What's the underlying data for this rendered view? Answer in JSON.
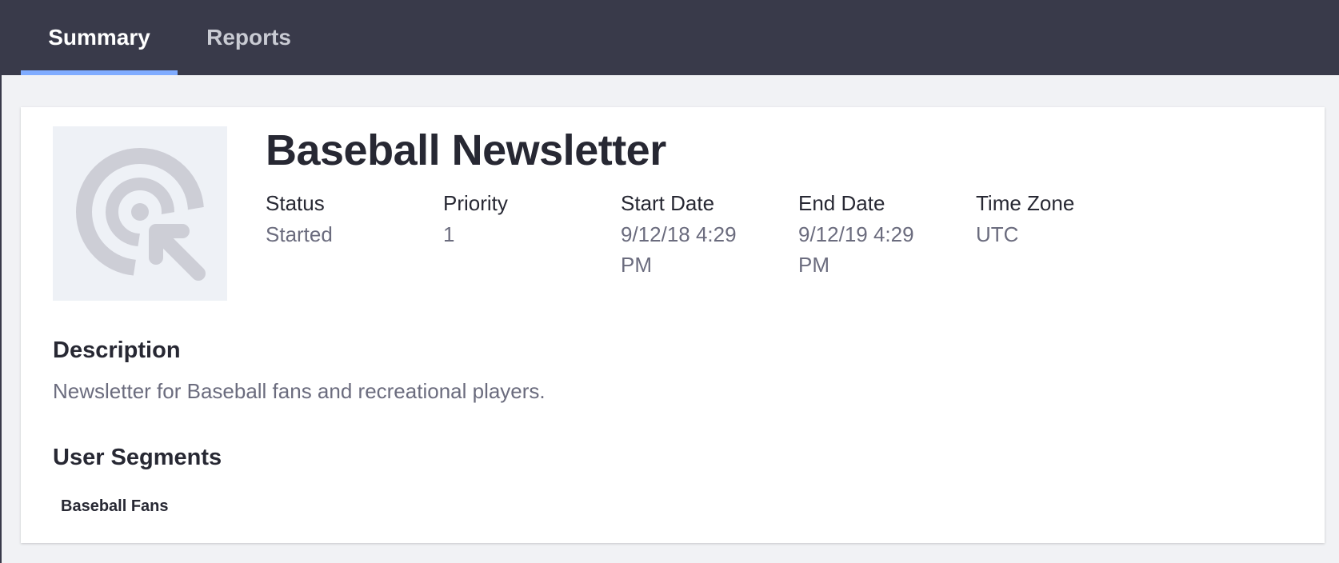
{
  "tabs": [
    {
      "label": "Summary",
      "active": true
    },
    {
      "label": "Reports",
      "active": false
    }
  ],
  "campaign": {
    "icon": "target-cursor-icon",
    "title": "Baseball Newsletter",
    "meta": {
      "status": {
        "label": "Status",
        "value": "Started"
      },
      "priority": {
        "label": "Priority",
        "value": "1"
      },
      "start_date": {
        "label": "Start Date",
        "value_line1": "9/12/18 4:29",
        "value_line2": "PM"
      },
      "end_date": {
        "label": "End Date",
        "value_line1": "9/12/19 4:29",
        "value_line2": "PM"
      },
      "time_zone": {
        "label": "Time Zone",
        "value": "UTC"
      }
    },
    "description": {
      "heading": "Description",
      "text": "Newsletter for Baseball fans and recreational players."
    },
    "user_segments": {
      "heading": "User Segments",
      "items": [
        "Baseball Fans"
      ]
    }
  },
  "colors": {
    "topbar": "#393a4a",
    "tab_indicator": "#80acff",
    "page_background": "#f1f2f5",
    "text_primary": "#272833",
    "text_secondary": "#6b6c7e",
    "icon_tile": "#eef1f6",
    "icon_glyph": "#cdced6"
  }
}
